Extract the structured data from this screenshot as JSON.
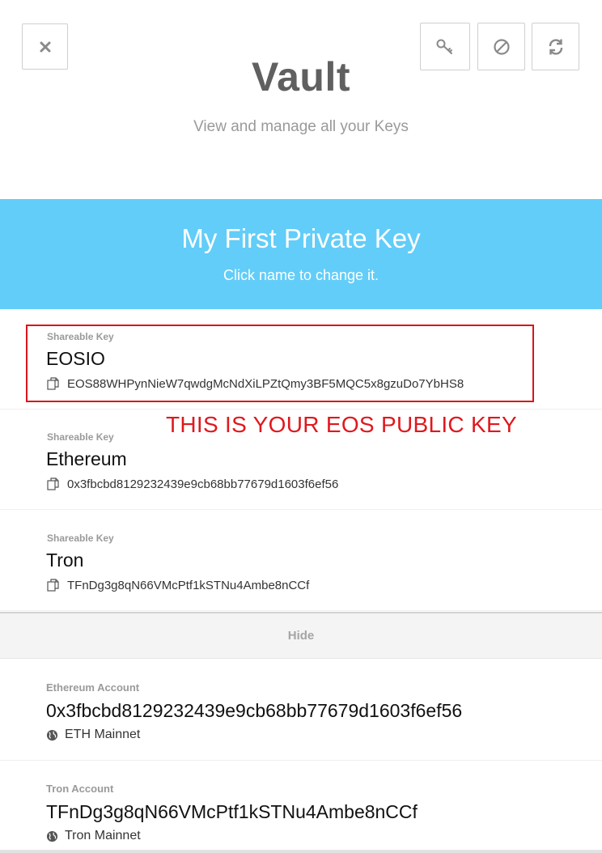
{
  "header": {
    "title": "Vault",
    "subtitle": "View and manage all your Keys",
    "icons": [
      "close-icon",
      "key-icon",
      "block-icon",
      "refresh-icon"
    ]
  },
  "banner": {
    "key_name": "My First Private Key",
    "hint": "Click name to change it.",
    "color": "#62cdf8"
  },
  "keys": [
    {
      "label": "Shareable Key",
      "blockchain": "EOSIO",
      "public_key": "EOS88WHPynNieW7qwdgMcNdXiLPZtQmy3BF5MQC5x8gzuDo7YbHS8"
    },
    {
      "label": "Shareable Key",
      "blockchain": "Ethereum",
      "public_key": "0x3fbcbd8129232439e9cb68bb77679d1603f6ef56"
    },
    {
      "label": "Shareable Key",
      "blockchain": "Tron",
      "public_key": "TFnDg3g8qN66VMcPtf1kSTNu4Ambe8nCCf"
    }
  ],
  "annotation": {
    "text": "THIS IS YOUR EOS PUBLIC KEY",
    "color": "#e0181e"
  },
  "hide_label": "Hide",
  "accounts": [
    {
      "label": "Ethereum Account",
      "name": "0x3fbcbd8129232439e9cb68bb77679d1603f6ef56",
      "network": "ETH Mainnet"
    },
    {
      "label": "Tron Account",
      "name": "TFnDg3g8qN66VMcPtf1kSTNu4Ambe8nCCf",
      "network": "Tron Mainnet"
    }
  ]
}
